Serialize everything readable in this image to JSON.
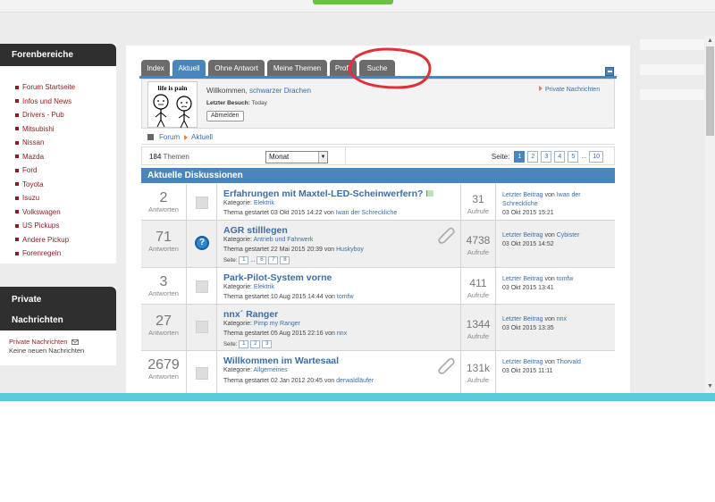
{
  "sidebar": {
    "forums_title": "Forenbereiche",
    "items": [
      {
        "label": "Forum Startseite"
      },
      {
        "label": "Infos und News"
      },
      {
        "label": "Drivers - Pub"
      },
      {
        "label": "Mitsubishi"
      },
      {
        "label": "Nissan"
      },
      {
        "label": "Mazda"
      },
      {
        "label": "Ford"
      },
      {
        "label": "Toyota"
      },
      {
        "label": "Isuzu"
      },
      {
        "label": "Volkswagen"
      },
      {
        "label": "US Pickups"
      },
      {
        "label": "Andere Pickup"
      },
      {
        "label": "Forenregeln"
      }
    ],
    "private_title_line1": "Private",
    "private_title_line2": "Nachrichten",
    "private_link": "Private Nachrichten",
    "private_status": "Keine neuen Nachrichten"
  },
  "tabs": [
    {
      "label": "Index"
    },
    {
      "label": "Aktuell"
    },
    {
      "label": "Ohne Antwort"
    },
    {
      "label": "Meine Themen"
    },
    {
      "label": "Profil"
    },
    {
      "label": "Suche"
    }
  ],
  "welcome": {
    "avatar_caption": "life is pain",
    "greeting": "Willkommen,",
    "username": "schwarzer Drachen",
    "last_visit_label": "Letzter Besuch:",
    "last_visit_value": "Today",
    "logout_label": "Abmelden",
    "pm_link": "Private Nachrichten"
  },
  "breadcrumb": {
    "forum": "Forum",
    "current": "Aktuell"
  },
  "filter": {
    "topic_count": "184",
    "topic_count_label": "Themen",
    "sort_value": "Monat",
    "page_label": "Seite:",
    "pages": [
      "1",
      "2",
      "3",
      "4",
      "5",
      "...",
      "10"
    ]
  },
  "list_title": "Aktuelle Diskussionen",
  "labels": {
    "replies": "Antworten",
    "views": "Aufrufe",
    "category": "Kategorie:",
    "started": "Thema gestartet",
    "by": "von",
    "page": "Seite:",
    "last_post": "Letzter Beitrag",
    "ellipsis": "..."
  },
  "topics": [
    {
      "replies": "2",
      "title": "Erfahrungen mit Maxtel-LED-Scheinwerfern?",
      "category": "Elektrik",
      "started_date": "03 Okt 2015 14:22",
      "author": "Iwan der Schreckliche",
      "views": "31",
      "last_by": "Iwan der Schreckliche",
      "last_date": "03 Okt 2015 15:21"
    },
    {
      "replies": "71",
      "title": "AGR stilllegen",
      "category": "Antrieb und Fahrwerk",
      "started_date": "22 Mai 2015 20:39",
      "author": "Huskyboy",
      "views": "4738",
      "last_by": "Cybister",
      "last_date": "03 Okt 2015 14:52",
      "pages": [
        "1",
        "6",
        "7",
        "8"
      ]
    },
    {
      "replies": "3",
      "title": "Park-Pilot-System vorne",
      "category": "Elektrik",
      "started_date": "10 Aug 2015 14:44",
      "author": "tomfw",
      "views": "411",
      "last_by": "tomfw",
      "last_date": "03 Okt 2015 13:41"
    },
    {
      "replies": "27",
      "title": "nnx´ Ranger",
      "category": "Pimp my Ranger",
      "started_date": "05 Aug 2015 22:16",
      "author": "nnx",
      "views": "1344",
      "last_by": "nnx",
      "last_date": "03 Okt 2015 13:35",
      "pages": [
        "1",
        "2",
        "3"
      ]
    },
    {
      "replies": "2679",
      "title": "Willkommen im Wartesaal",
      "category": "Allgemeines",
      "started_date": "02 Jan 2012 20:45",
      "author": "derwaldläufer",
      "views": "131k",
      "last_by": "Thorvald",
      "last_date": "03 Okt 2015 11:11"
    }
  ],
  "colors": {
    "accent": "#4a86be",
    "tab_inactive": "#6b6b6b",
    "sidebar_header": "#2f2f2f",
    "sidebar_link": "#8b1d1d",
    "annotation": "#e0303a",
    "bottom_bar": "#5bc9dc"
  },
  "icons": {
    "bullet": "square-bullet-icon",
    "pm": "envelope-icon",
    "home": "home-icon",
    "breadcrumb_arrow": "arrow-right-icon",
    "collapse": "minimize-icon",
    "topic": "document-icon",
    "question": "question-icon",
    "attachment": "paperclip-icon"
  }
}
